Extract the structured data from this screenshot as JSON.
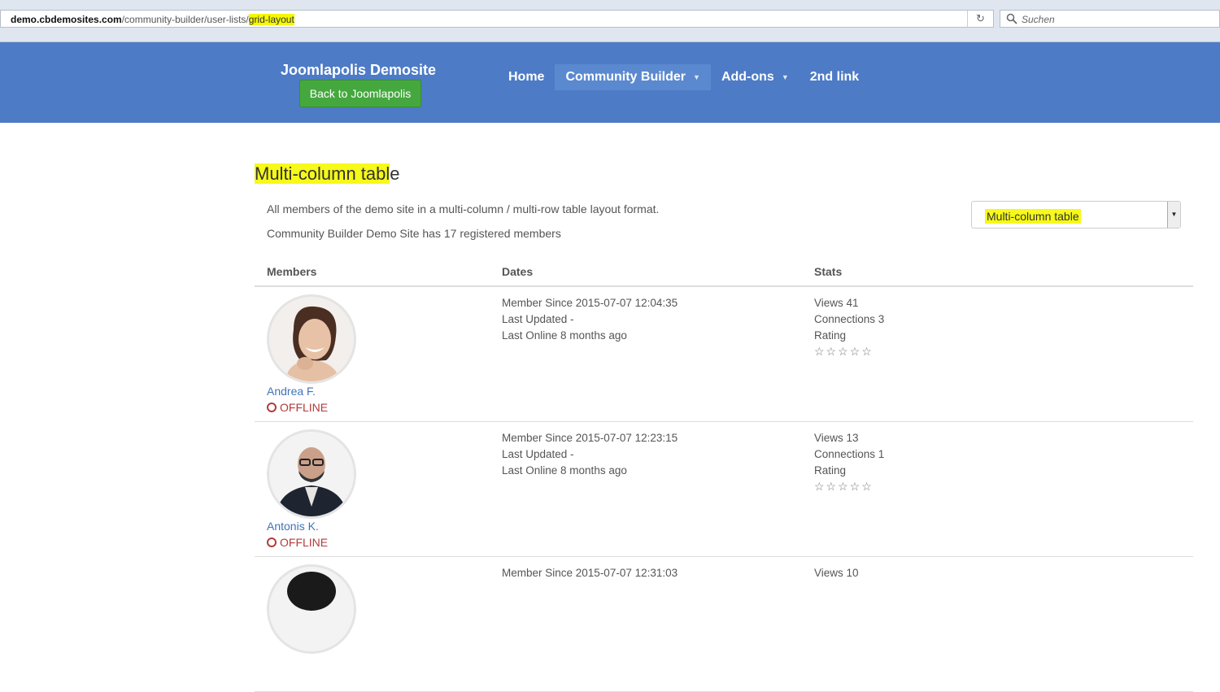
{
  "browser": {
    "url_host": "demo.cbdemosites.com",
    "url_path": "/community-builder/user-lists/",
    "url_highlight": "grid-layout",
    "search_placeholder": "Suchen"
  },
  "header": {
    "brand": "Joomlapolis Demosite",
    "back_button": "Back to Joomlapolis",
    "nav": [
      {
        "label": "Home",
        "has_caret": false,
        "active": false
      },
      {
        "label": "Community Builder",
        "has_caret": true,
        "active": true
      },
      {
        "label": "Add-ons",
        "has_caret": true,
        "active": false
      },
      {
        "label": "2nd link",
        "has_caret": false,
        "active": false
      }
    ]
  },
  "main": {
    "title_highlighted": "Multi-column tabl",
    "title_rest": "e",
    "description": "All members of the demo site in a multi-column / multi-row table layout format.",
    "member_count": "Community Builder Demo Site has 17 registered members",
    "layout_select_value": "Multi-column table"
  },
  "table": {
    "headers": {
      "members": "Members",
      "dates": "Dates",
      "stats": "Stats"
    },
    "rows": [
      {
        "name": "Andrea F.",
        "status": "OFFLINE",
        "member_since": "Member Since 2015-07-07 12:04:35",
        "last_updated": "Last Updated -",
        "last_online": "Last Online 8 months ago",
        "views": "Views 41",
        "connections": "Connections 3",
        "rating_label": "Rating",
        "rating_stars": "☆☆☆☆☆"
      },
      {
        "name": "Antonis K.",
        "status": "OFFLINE",
        "member_since": "Member Since 2015-07-07 12:23:15",
        "last_updated": "Last Updated -",
        "last_online": "Last Online 8 months ago",
        "views": "Views 13",
        "connections": "Connections 1",
        "rating_label": "Rating",
        "rating_stars": "☆☆☆☆☆"
      },
      {
        "name": "",
        "status": "",
        "member_since": "Member Since 2015-07-07 12:31:03",
        "last_updated": "",
        "last_online": "",
        "views": "Views 10",
        "connections": "",
        "rating_label": "",
        "rating_stars": ""
      }
    ]
  },
  "colors": {
    "header_bg": "#4d7bc6",
    "button_green": "#45a83e",
    "highlight": "#f5f800",
    "offline_red": "#b33b3b",
    "link_blue": "#3f74b8"
  }
}
